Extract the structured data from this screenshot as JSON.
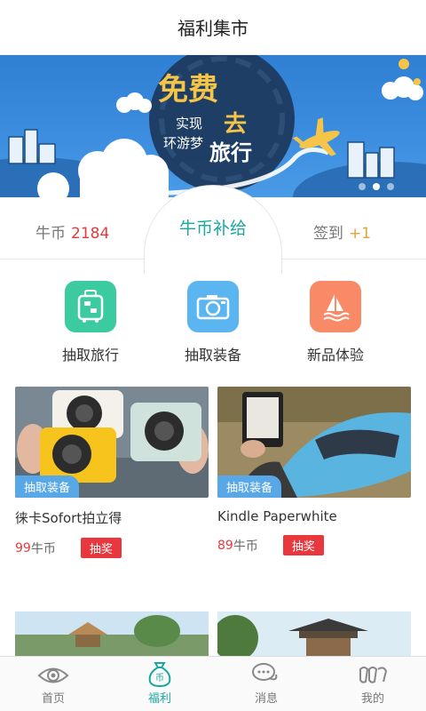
{
  "header": {
    "title": "福利集市"
  },
  "banner": {
    "headline_big": "免费",
    "headline_small": "去",
    "line1": "实现",
    "line2": "环游梦",
    "line3": "旅行",
    "dots": 3,
    "active_dot": 1
  },
  "coins": {
    "label": "牛币",
    "value": "2184",
    "center_label": "牛币补给",
    "signin_label": "签到",
    "signin_bonus": "+1"
  },
  "categories": [
    {
      "label": "抽取旅行",
      "icon": "luggage-icon",
      "color": "#3ccaa0"
    },
    {
      "label": "抽取装备",
      "icon": "camera-icon",
      "color": "#5bb5f0"
    },
    {
      "label": "新品体验",
      "icon": "sailboat-icon",
      "color": "#f98a68"
    }
  ],
  "products": [
    {
      "tag": "抽取装备",
      "name": "徕卡Sofort拍立得",
      "price": "99",
      "unit": "牛币",
      "action": "抽奖"
    },
    {
      "tag": "抽取装备",
      "name": "Kindle Paperwhite",
      "price": "89",
      "unit": "牛币",
      "action": "抽奖"
    }
  ],
  "tabs": [
    {
      "label": "首页",
      "icon": "eye-icon",
      "active": false
    },
    {
      "label": "福利",
      "icon": "coin-bag-icon",
      "active": true
    },
    {
      "label": "消息",
      "icon": "chat-icon",
      "active": false
    },
    {
      "label": "我的",
      "icon": "profile-icon",
      "active": false
    }
  ],
  "colors": {
    "accent": "#1aa7a0",
    "price": "#e8383d",
    "tag": "#58a8e8",
    "bonus": "#e3a23a"
  }
}
